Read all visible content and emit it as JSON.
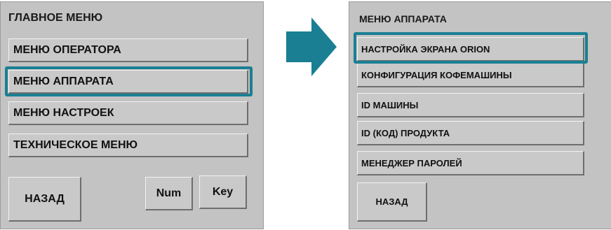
{
  "main_menu": {
    "title": "ГЛАВНОЕ МЕНЮ",
    "items": [
      "МЕНЮ ОПЕРАТОРА",
      "МЕНЮ АППАРАТА",
      "МЕНЮ НАСТРОЕК",
      "ТЕХНИЧЕСКОЕ МЕНЮ"
    ],
    "back_label": "НАЗАД",
    "num_label": "Num",
    "key_label": "Key"
  },
  "machine_menu": {
    "title": "МЕНЮ АППАРАТА",
    "items": [
      "НАСТРОЙКА ЭКРАНА ORION",
      "КОНФИГУРАЦИЯ КОФЕМАШИНЫ",
      "ID МАШИНЫ",
      "ID (КОД) ПРОДУКТА",
      "МЕНЕДЖЕР ПАРОЛЕЙ"
    ],
    "back_label": "НАЗАД"
  },
  "colors": {
    "highlight": "#1a7f93",
    "arrow": "#1a7f93",
    "panel": "#c3c3c3"
  },
  "icons": {
    "arrow": "arrow-right-icon"
  }
}
